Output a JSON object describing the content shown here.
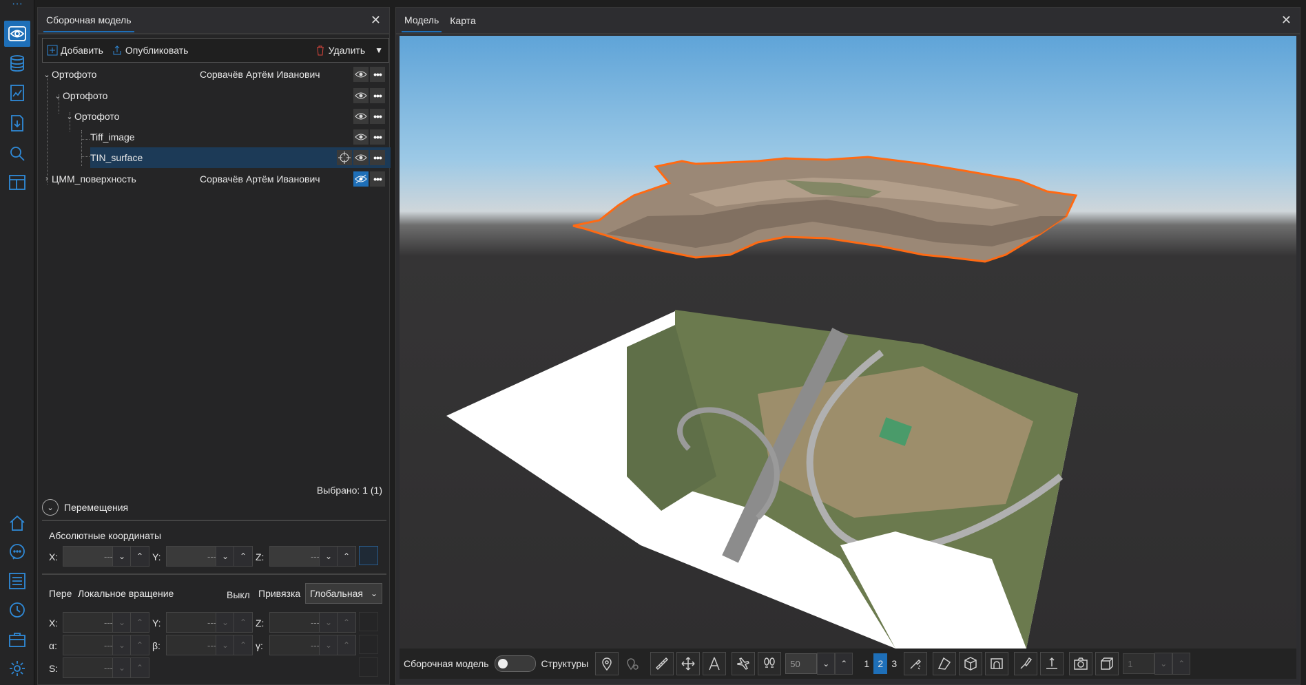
{
  "rail": {
    "top_dots": "···",
    "icons": [
      "eye-icon",
      "database-icon",
      "report-icon",
      "import-icon",
      "search-icon",
      "layout-icon",
      "home-icon",
      "chat-icon",
      "list-icon",
      "history-icon",
      "briefcase-icon",
      "settings-icon"
    ]
  },
  "panel": {
    "title": "Сборочная модель",
    "close": "✕",
    "toolbar": {
      "add": "Добавить",
      "publish": "Опубликовать",
      "delete": "Удалить",
      "dropdown": "▼"
    },
    "tree": [
      {
        "label": "Ортофото",
        "owner": "Сорвачёв Артём Иванович",
        "caret": "⌄"
      },
      {
        "label": "Ортофото",
        "owner": "",
        "caret": "⌄"
      },
      {
        "label": "Ортофото",
        "owner": "",
        "caret": "⌄"
      },
      {
        "label": "Tiff_image",
        "owner": "",
        "caret": ""
      },
      {
        "label": "TIN_surface",
        "owner": "",
        "caret": ""
      },
      {
        "label": "ЦММ_поверхность",
        "owner": "Сорвачёв Артём Иванович",
        "caret": "›"
      }
    ],
    "selected_count": "Выбрано: 1 (1)",
    "moves": {
      "header": "Перемещения",
      "abs_title": "Абсолютные координаты",
      "x": "X:",
      "y": "Y:",
      "z": "Z:",
      "placeholder": "---",
      "pere": "Пере",
      "local_rotation": "Локальное вращение",
      "off": "Выкл",
      "binding": "Привязка",
      "binding_value": "Глобальная",
      "alpha": "α:",
      "beta": "β:",
      "gamma": "γ:",
      "s": "S:"
    }
  },
  "viewport": {
    "tabs": [
      "Модель",
      "Карта"
    ],
    "close": "✕",
    "bottom": {
      "assembly": "Сборочная модель",
      "structures": "Структуры",
      "lod": "50",
      "levels": [
        "1",
        "2",
        "3"
      ],
      "active_level": "2",
      "page": "1"
    }
  },
  "colors": {
    "accent": "#1e6fb8",
    "panel_bg": "#252526",
    "outline": "#ff6a13"
  }
}
